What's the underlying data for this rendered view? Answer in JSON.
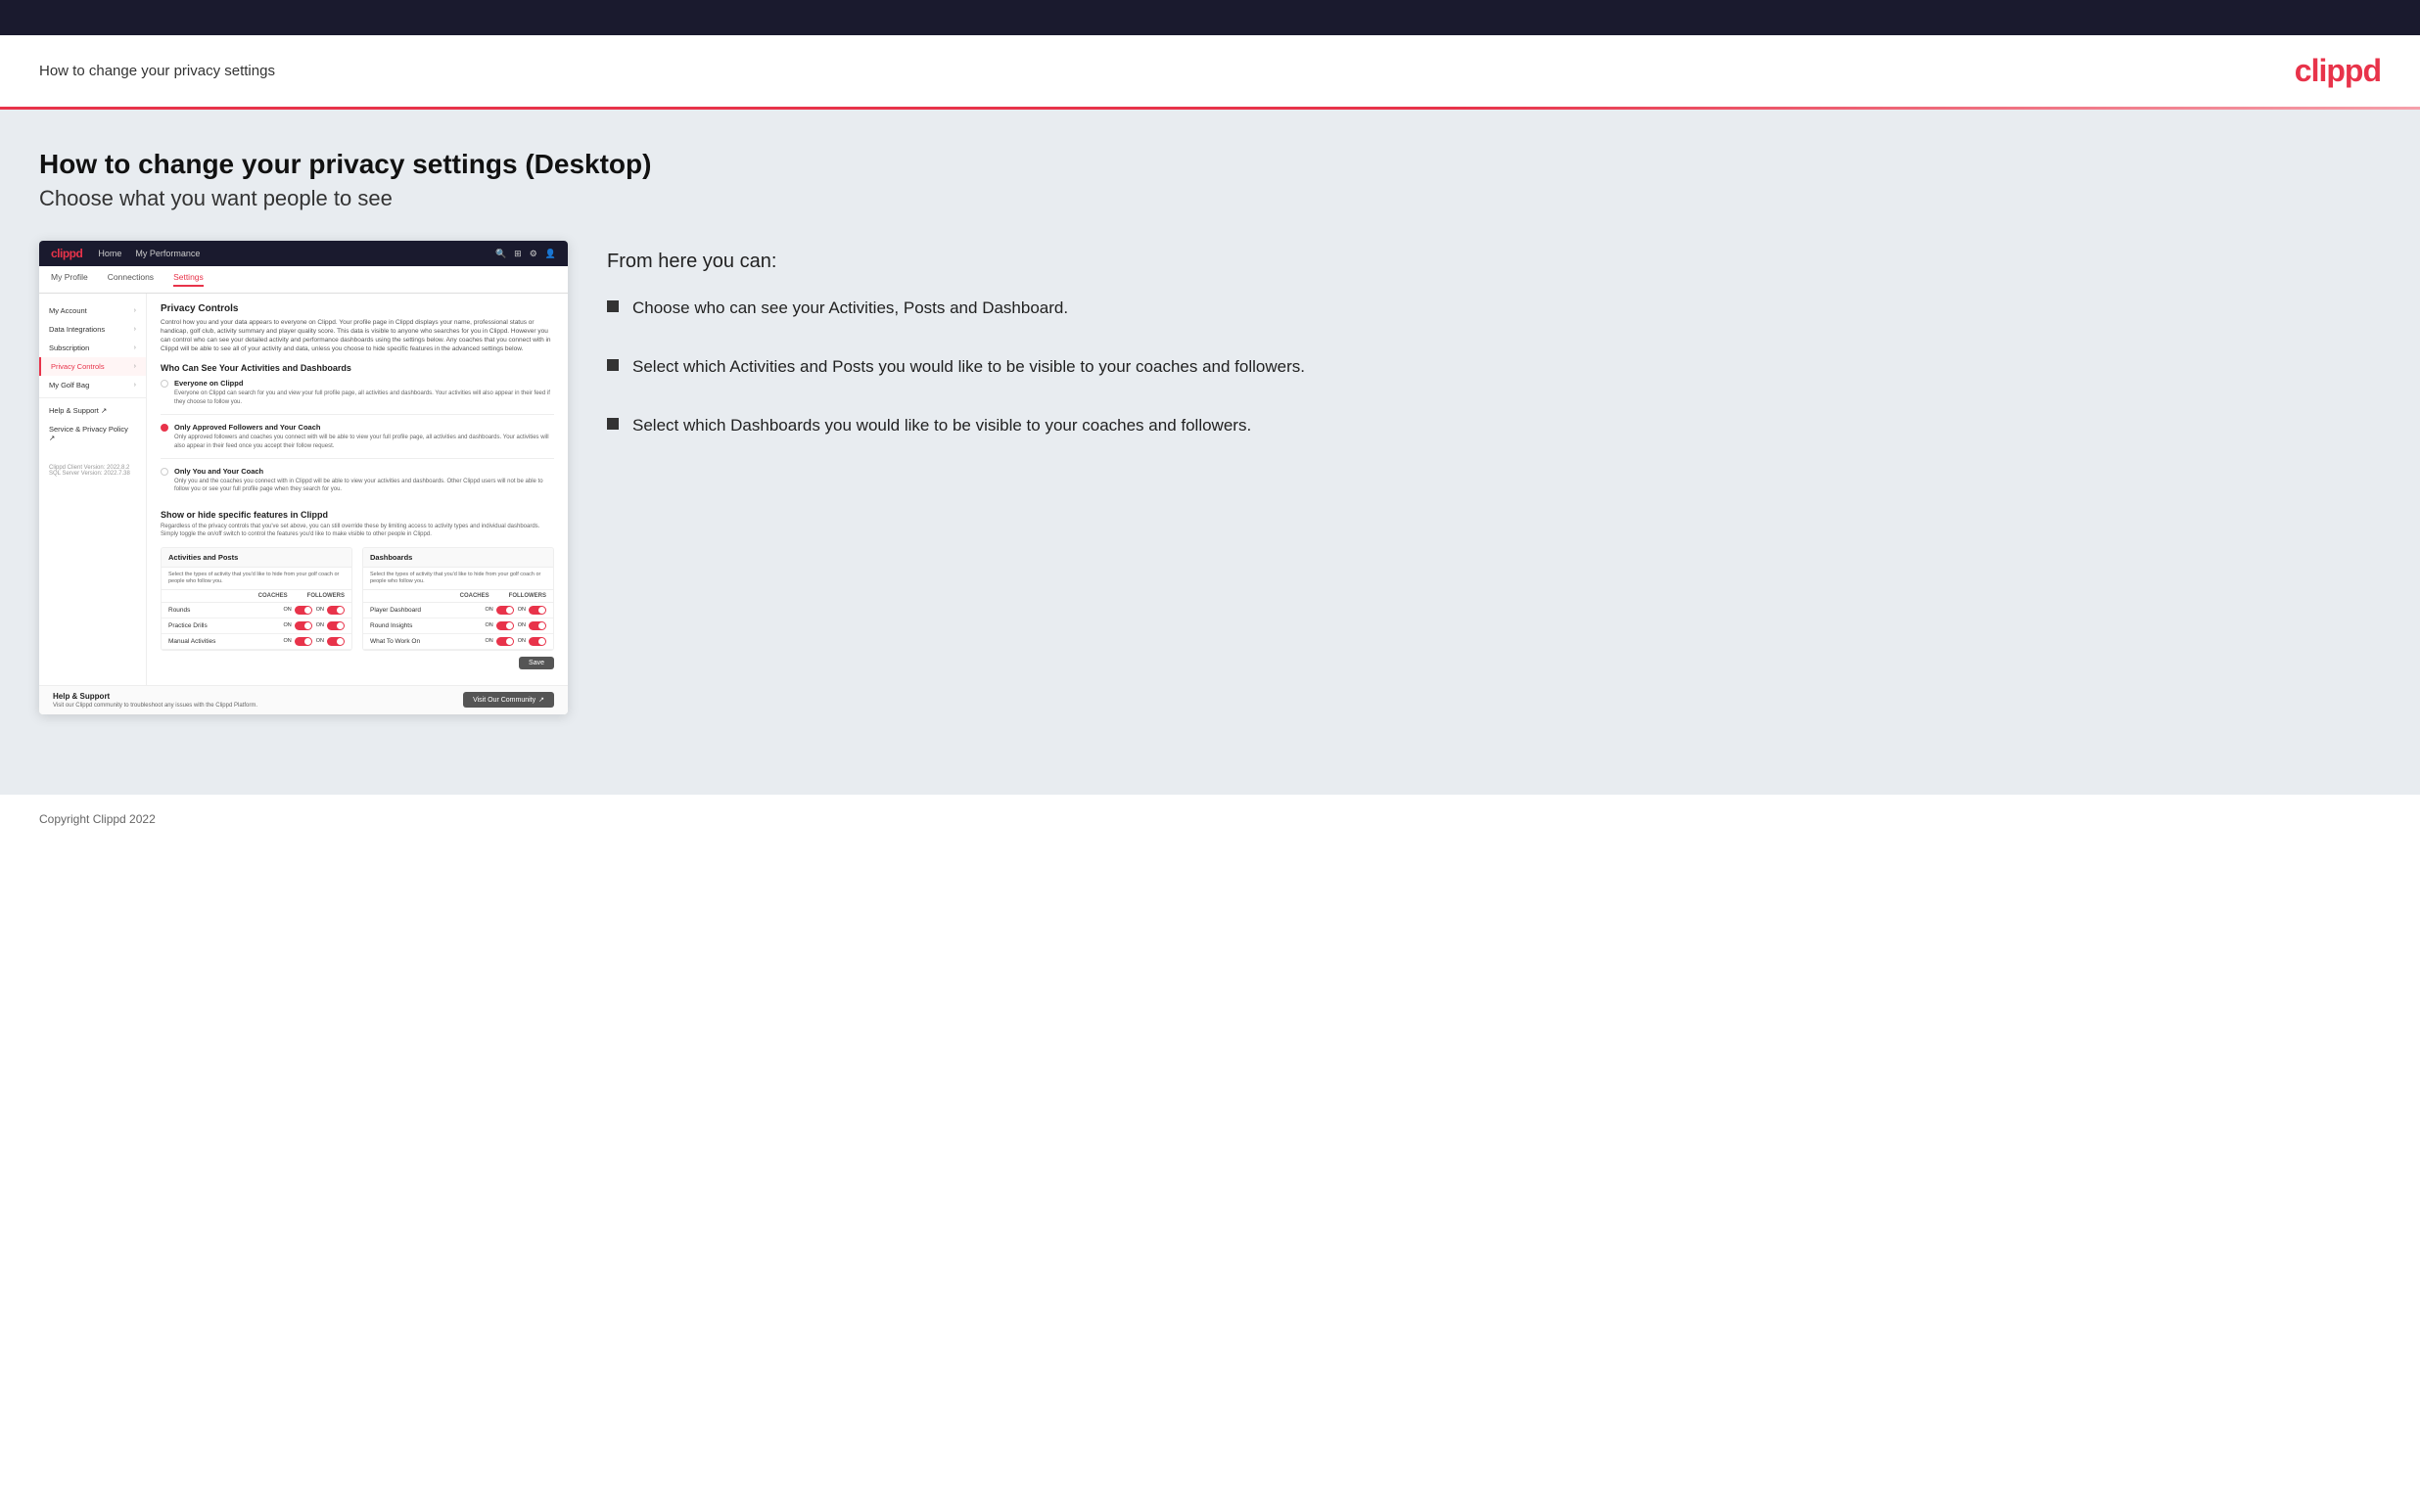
{
  "topbar": {},
  "header": {
    "title": "How to change your privacy settings",
    "logo": "clippd"
  },
  "main": {
    "heading": "How to change your privacy settings (Desktop)",
    "subheading": "Choose what you want people to see"
  },
  "app_screenshot": {
    "nav": {
      "logo": "clippd",
      "links": [
        "Home",
        "My Performance"
      ],
      "icons": [
        "search",
        "grid",
        "settings",
        "user"
      ]
    },
    "sub_nav": [
      {
        "label": "My Profile",
        "active": false
      },
      {
        "label": "Connections",
        "active": false
      },
      {
        "label": "Settings",
        "active": true
      }
    ],
    "sidebar": {
      "items": [
        {
          "label": "My Account",
          "active": false
        },
        {
          "label": "Data Integrations",
          "active": false
        },
        {
          "label": "Subscription",
          "active": false
        },
        {
          "label": "Privacy Controls",
          "active": true
        },
        {
          "label": "My Golf Bag",
          "active": false
        },
        {
          "label": "Help & Support",
          "active": false,
          "external": true
        },
        {
          "label": "Service & Privacy Policy",
          "active": false,
          "external": true
        }
      ],
      "version": "Clippd Client Version: 2022.8.2\nSQL Server Version: 2022.7.38"
    },
    "privacy": {
      "title": "Privacy Controls",
      "description": "Control how you and your data appears to everyone on Clippd. Your profile page in Clippd displays your name, professional status or handicap, golf club, activity summary and player quality score. This data is visible to anyone who searches for you in Clippd. However you can control who can see your detailed activity and performance dashboards using the settings below. Any coaches that you connect with in Clippd will be able to see all of your activity and data, unless you choose to hide specific features in the advanced settings below.",
      "who_can_see_title": "Who Can See Your Activities and Dashboards",
      "options": [
        {
          "label": "Everyone on Clippd",
          "description": "Everyone on Clippd can search for you and view your full profile page, all activities and dashboards. Your activities will also appear in their feed if they choose to follow you.",
          "selected": false
        },
        {
          "label": "Only Approved Followers and Your Coach",
          "description": "Only approved followers and coaches you connect with will be able to view your full profile page, all activities and dashboards. Your activities will also appear in their feed once you accept their follow request.",
          "selected": true
        },
        {
          "label": "Only You and Your Coach",
          "description": "Only you and the coaches you connect with in Clippd will be able to view your activities and dashboards. Other Clippd users will not be able to follow you or see your full profile page when they search for you.",
          "selected": false
        }
      ],
      "show_hide_title": "Show or hide specific features in Clippd",
      "show_hide_desc": "Regardless of the privacy controls that you've set above, you can still override these by limiting access to activity types and individual dashboards. Simply toggle the on/off switch to control the features you'd like to make visible to other people in Clippd.",
      "activities_table": {
        "title": "Activities and Posts",
        "description": "Select the types of activity that you'd like to hide from your golf coach or people who follow you.",
        "cols": [
          "COACHES",
          "FOLLOWERS"
        ],
        "rows": [
          {
            "label": "Rounds",
            "coaches": true,
            "followers": true
          },
          {
            "label": "Practice Drills",
            "coaches": true,
            "followers": true
          },
          {
            "label": "Manual Activities",
            "coaches": true,
            "followers": true
          }
        ]
      },
      "dashboards_table": {
        "title": "Dashboards",
        "description": "Select the types of activity that you'd like to hide from your golf coach or people who follow you.",
        "cols": [
          "COACHES",
          "FOLLOWERS"
        ],
        "rows": [
          {
            "label": "Player Dashboard",
            "coaches": true,
            "followers": true
          },
          {
            "label": "Round Insights",
            "coaches": true,
            "followers": true
          },
          {
            "label": "What To Work On",
            "coaches": true,
            "followers": true
          }
        ]
      },
      "save_label": "Save",
      "help": {
        "title": "Help & Support",
        "description": "Visit our Clippd community to troubleshoot any issues with the Clippd Platform.",
        "button_label": "Visit Our Community"
      }
    }
  },
  "bullets": {
    "from_here_text": "From here you can:",
    "items": [
      "Choose who can see your Activities, Posts and Dashboard.",
      "Select which Activities and Posts you would like to be visible to your coaches and followers.",
      "Select which Dashboards you would like to be visible to your coaches and followers."
    ]
  },
  "footer": {
    "copyright": "Copyright Clippd 2022"
  }
}
